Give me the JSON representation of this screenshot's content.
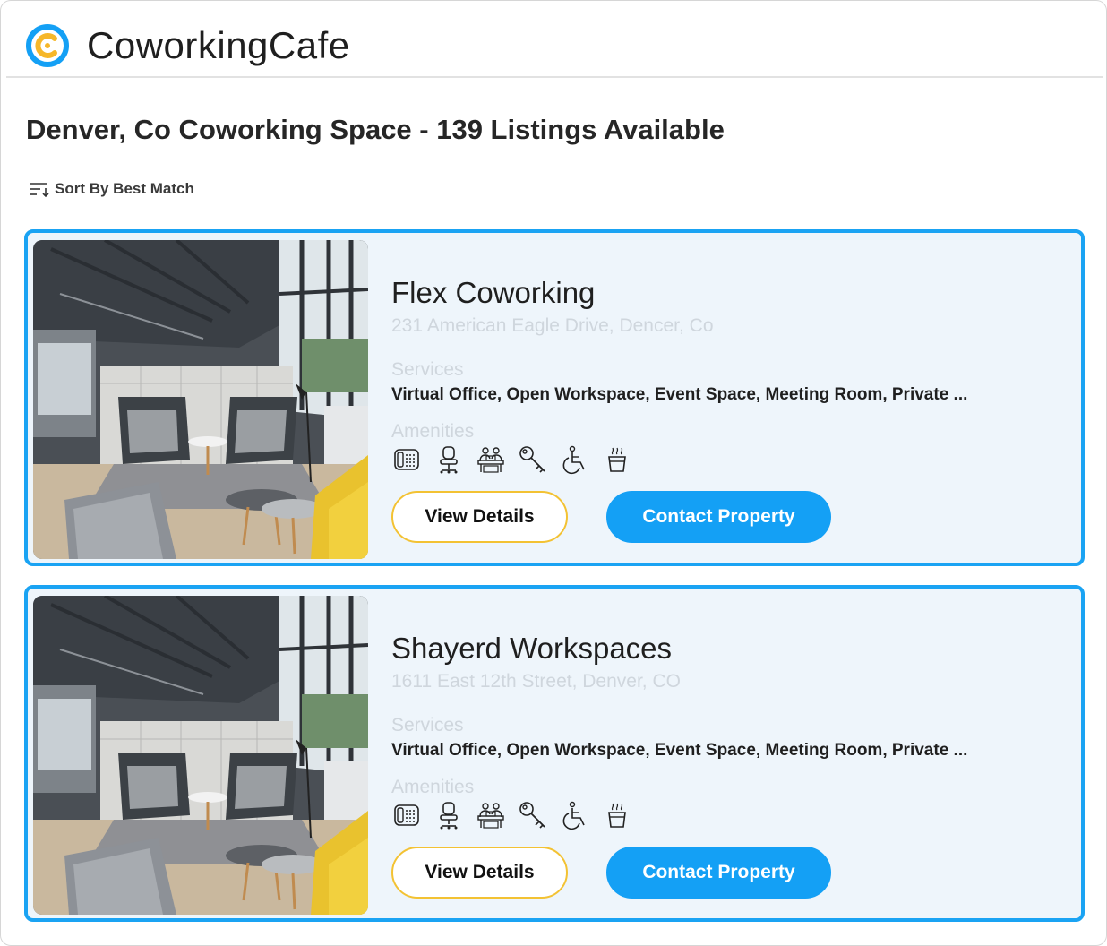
{
  "brand": {
    "name": "CoworkingCafe",
    "logo_icon": "coworkingcafe-logo-icon"
  },
  "colors": {
    "accent_blue": "#14a0f5",
    "card_border": "#1aa3f3",
    "card_background": "#eef5fb",
    "details_button_border": "#f3c233",
    "logo_yellow": "#f6b72a"
  },
  "page": {
    "title": "Denver, Co Coworking Space - 139 Listings Available"
  },
  "sort": {
    "label": "Sort By Best Match",
    "icon": "sort-icon"
  },
  "listings": [
    {
      "name": "Flex Coworking",
      "address": "231 American Eagle Drive, Dencer, Co",
      "services_label": "Services",
      "services": "Virtual Office, Open Workspace, Event Space, Meeting Room, Private ...",
      "amenities_label": "Amenities",
      "amenity_icons": [
        "phone-icon",
        "office-chair-icon",
        "meeting-table-icon",
        "key-icon",
        "wheelchair-accessible-icon",
        "coffee-cup-icon"
      ],
      "details_label": "View Details",
      "contact_label": "Contact Property"
    },
    {
      "name": "Shayerd Workspaces",
      "address": "1611 East 12th Street, Denver, CO",
      "services_label": "Services",
      "services": "Virtual Office, Open Workspace, Event Space, Meeting Room, Private ...",
      "amenities_label": "Amenities",
      "amenity_icons": [
        "phone-icon",
        "office-chair-icon",
        "meeting-table-icon",
        "key-icon",
        "wheelchair-accessible-icon",
        "coffee-cup-icon"
      ],
      "details_label": "View Details",
      "contact_label": "Contact Property"
    }
  ]
}
